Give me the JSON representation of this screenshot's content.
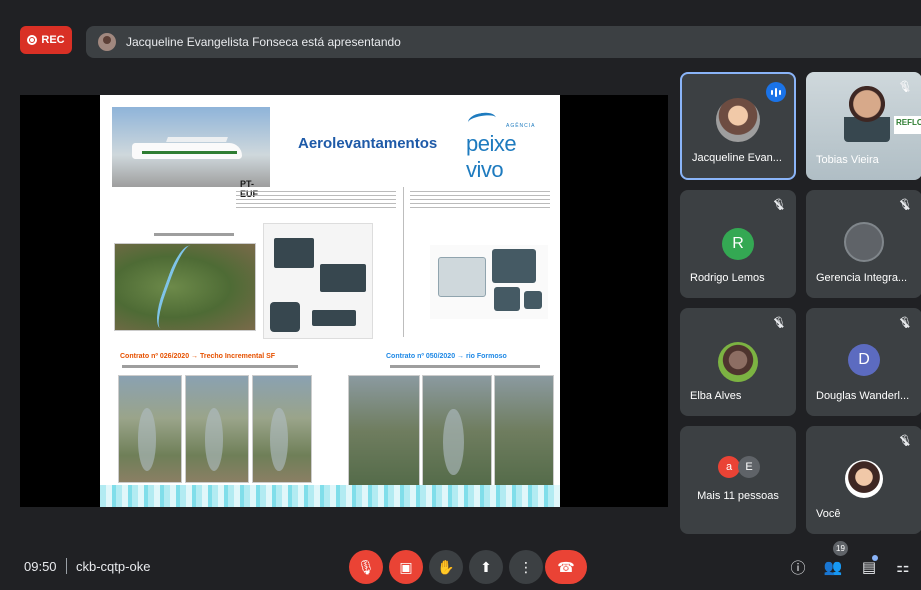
{
  "top": {
    "rec_label": "REC",
    "presenting_text": "Jacqueline Evangelista Fonseca está apresentando"
  },
  "slide": {
    "title": "Aerolevantamentos",
    "logo_agency": "AGÊNCIA",
    "logo_word": "peixe vivo",
    "plane_registration": "PT-EUF",
    "contract_1": "Contrato nº 026/2020 → Trecho Incremental SF",
    "contract_2": "Contrato nº 050/2020 → rio Formoso"
  },
  "participants": [
    {
      "name": "Jacqueline Evan...",
      "state": "speaking"
    },
    {
      "name": "Tobias Vieira",
      "banner": "REFLO"
    },
    {
      "name": "Rodrigo Lemos",
      "initial": "R",
      "color": "#34a853"
    },
    {
      "name": "Gerencia Integra..."
    },
    {
      "name": "Elba Alves"
    },
    {
      "name": "Douglas Wanderl...",
      "initial": "D",
      "color": "#5c6bc0"
    },
    {
      "name": "Mais 11 pessoas",
      "initials": [
        "a",
        "E"
      ]
    },
    {
      "name": "Você"
    }
  ],
  "bottom": {
    "time": "09:50",
    "meeting_code": "ckb-cqtp-oke",
    "participant_count": "19"
  },
  "colors": {
    "end_call": "#ea4335",
    "speaking": "#1a73e8",
    "tile": "#3c4043"
  }
}
